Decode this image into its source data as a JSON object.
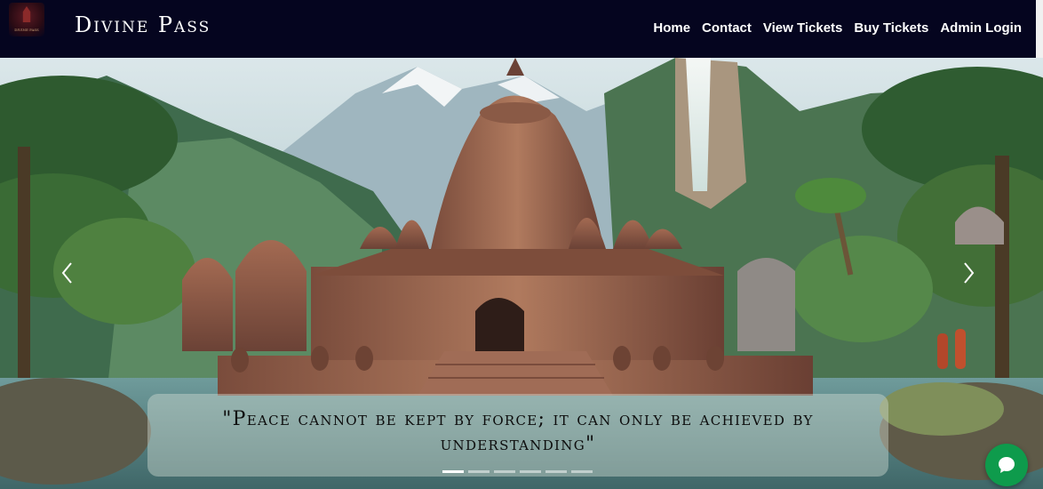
{
  "brand": {
    "name": "Divine Pass",
    "logo_text": "DIVINE PASS",
    "logo_icon": "temple-logo-icon"
  },
  "nav": {
    "items": [
      {
        "label": "Home"
      },
      {
        "label": "Contact"
      },
      {
        "label": "View Tickets"
      },
      {
        "label": "Buy Tickets"
      },
      {
        "label": "Admin Login"
      }
    ]
  },
  "carousel": {
    "caption": "\"Peace cannot be kept by force; it can only be achieved by understanding\"",
    "slide_count": 6,
    "active_index": 0,
    "prev_icon": "chevron-left-icon",
    "next_icon": "chevron-right-icon"
  },
  "chat": {
    "icon": "chat-bubble-icon",
    "color": "#0e9b4c"
  },
  "colors": {
    "navbar_bg": "#05051f",
    "nav_text": "#ffffff"
  }
}
